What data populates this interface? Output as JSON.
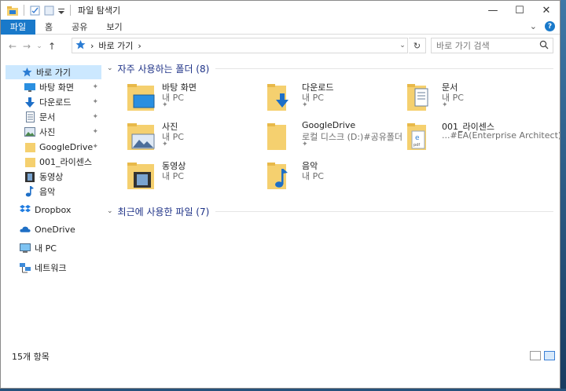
{
  "window": {
    "title": "파일 탐색기"
  },
  "titlebar": {
    "minimize": "—",
    "maximize": "☐",
    "close": "✕"
  },
  "ribbon": {
    "tabs": [
      "파일",
      "홈",
      "공유",
      "보기"
    ],
    "collapse": "⌄",
    "help": "?"
  },
  "address": {
    "back": "←",
    "forward": "→",
    "recent": "⌄",
    "up": "↑",
    "sep": "›",
    "crumb": "바로 가기",
    "sep2": "›",
    "dropdown": "⌄",
    "refresh": "↻"
  },
  "search": {
    "placeholder": "바로 가기 검색",
    "icon": "⚲"
  },
  "sidebar": {
    "items": [
      {
        "label": "바로 가기",
        "icon": "quick-access-icon",
        "pinned": false,
        "selected": true
      },
      {
        "label": "바탕 화면",
        "icon": "desktop-icon",
        "pinned": true
      },
      {
        "label": "다운로드",
        "icon": "download-icon",
        "pinned": true
      },
      {
        "label": "문서",
        "icon": "document-icon",
        "pinned": true
      },
      {
        "label": "사진",
        "icon": "picture-icon",
        "pinned": true
      },
      {
        "label": "GoogleDrive",
        "icon": "folder-icon",
        "pinned": true
      },
      {
        "label": "001_라이센스",
        "icon": "folder-icon",
        "pinned": false
      },
      {
        "label": "동영상",
        "icon": "video-icon",
        "pinned": false
      },
      {
        "label": "음악",
        "icon": "music-icon",
        "pinned": false
      },
      {
        "label": "Dropbox",
        "icon": "dropbox-icon",
        "pinned": false
      },
      {
        "label": "OneDrive",
        "icon": "onedrive-icon",
        "pinned": false
      },
      {
        "label": "내 PC",
        "icon": "pc-icon",
        "pinned": false
      },
      {
        "label": "네트워크",
        "icon": "network-icon",
        "pinned": false
      }
    ],
    "pin_glyph": "📌"
  },
  "groups": {
    "frequent": {
      "label": "자주 사용하는 폴더 (8)",
      "chevron": "⌄"
    },
    "recent": {
      "label": "최근에 사용한 파일 (7)",
      "chevron": "⌄"
    }
  },
  "folders": [
    {
      "name": "바탕 화면",
      "sub": "내 PC",
      "icon": "desktop-folder-icon",
      "pinned": true
    },
    {
      "name": "다운로드",
      "sub": "내 PC",
      "icon": "download-folder-icon",
      "pinned": true
    },
    {
      "name": "문서",
      "sub": "내 PC",
      "icon": "documents-folder-icon",
      "pinned": true
    },
    {
      "name": "사진",
      "sub": "내 PC",
      "icon": "pictures-folder-icon",
      "pinned": true
    },
    {
      "name": "GoogleDrive",
      "sub": "로컬 디스크 (D:)#공유폴더",
      "icon": "folder-icon",
      "pinned": true
    },
    {
      "name": "001_라이센스",
      "sub": "...#EA(Enterprise Architect)",
      "icon": "pdf-folder-icon",
      "pinned": false
    },
    {
      "name": "동영상",
      "sub": "내 PC",
      "icon": "video-folder-icon",
      "pinned": false
    },
    {
      "name": "음악",
      "sub": "내 PC",
      "icon": "music-folder-icon",
      "pinned": false
    }
  ],
  "status": {
    "count": "15개 항목"
  },
  "colors": {
    "accent": "#1979ca",
    "group_header": "#1e3287",
    "selected": "#cce8ff",
    "folder": "#f5d06f"
  }
}
